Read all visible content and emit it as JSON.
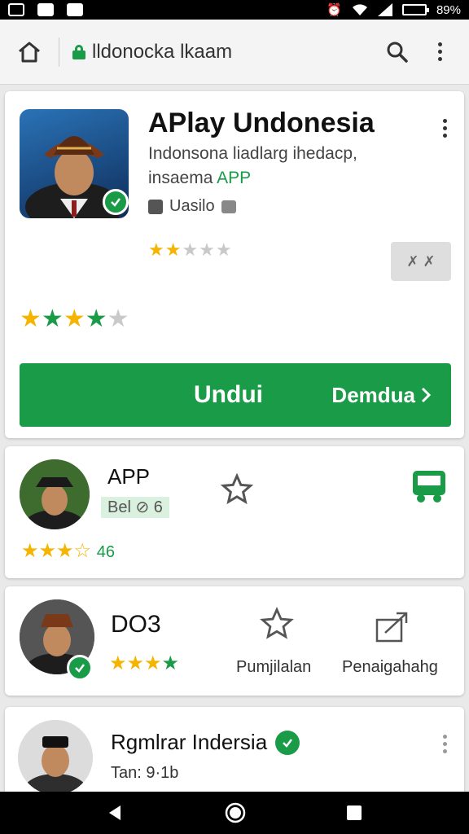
{
  "browser": {
    "url": "lldonocka lkaam"
  },
  "app": {
    "title": "APlay Undonesia",
    "subtitle_line1": "Indonsona liadlarg ihedacp,",
    "subtitle_line2_prefix": "insaema ",
    "subtitle_line2_highlight": "APP",
    "developer": "Uasilo",
    "small_rating_stars": "★★☆☆☆",
    "secondary_button_label": "✗ ✗",
    "big_rating_stars": "★★★★★",
    "install_label": "Undui",
    "more_label": "Demdua"
  },
  "list": [
    {
      "title": "APP",
      "meta_highlight": "Bel ⊘ 6",
      "rating_text": "46",
      "stars": "★★★☆"
    },
    {
      "title": "DO3",
      "stars": "★★★★",
      "action1_label": "Pumjilalan",
      "action2_label": "Penaigahahg"
    },
    {
      "title": "Rgmlrar Indersia",
      "meta": "Tan: 9·1b"
    }
  ],
  "colors": {
    "accent": "#1a9b48",
    "star": "#f4b400"
  },
  "icons": [
    "home-icon",
    "lock-icon",
    "search-icon",
    "overflow-menu-icon",
    "verified-icon",
    "star-outline-icon",
    "bus-icon",
    "share-icon",
    "back-icon",
    "home-nav-icon",
    "recents-icon"
  ]
}
